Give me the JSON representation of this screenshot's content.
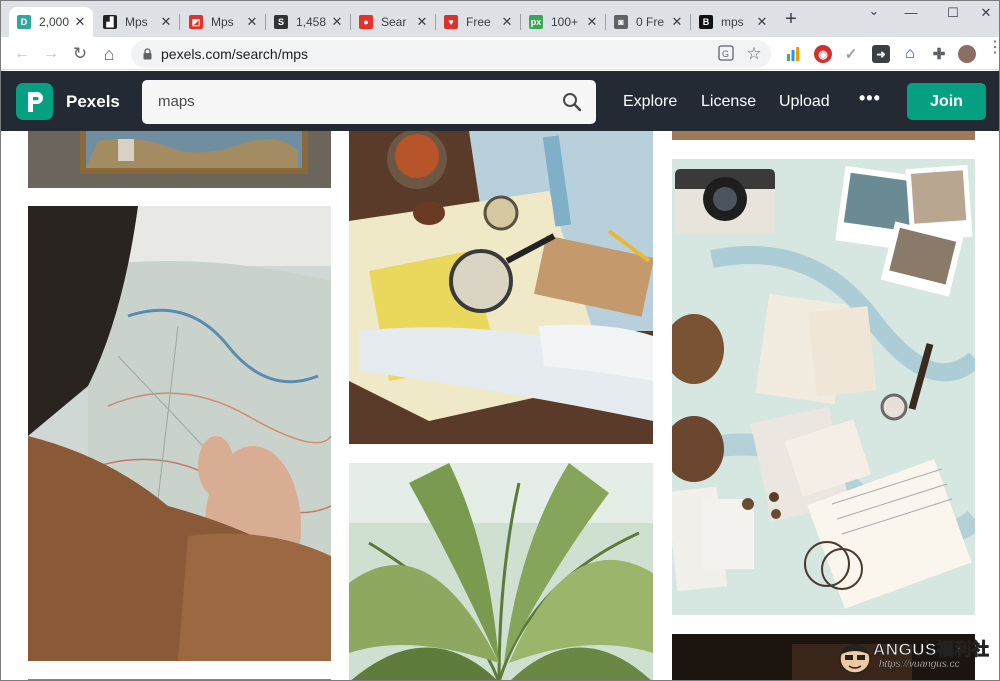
{
  "browser": {
    "tabs": [
      {
        "title": "2,000",
        "color": "#2ea7a0",
        "glyph": "D",
        "active": true
      },
      {
        "title": "Mps",
        "color": "#222222",
        "glyph": "▟",
        "active": false
      },
      {
        "title": "Mps",
        "color": "#e4322b",
        "glyph": "◩",
        "active": false
      },
      {
        "title": "1,458",
        "color": "#333333",
        "glyph": "S",
        "active": false
      },
      {
        "title": "Sear",
        "color": "#e4322b",
        "glyph": "●",
        "active": false
      },
      {
        "title": "Free",
        "color": "#d9342b",
        "glyph": "♥",
        "active": false
      },
      {
        "title": "100+",
        "color": "#3aa757",
        "glyph": "px",
        "active": false
      },
      {
        "title": "0 Fre",
        "color": "#5f6368",
        "glyph": "◙",
        "active": false
      },
      {
        "title": "mps",
        "color": "#111111",
        "glyph": "B",
        "active": false
      }
    ],
    "new_tab_label": "+",
    "window_controls": {
      "minimize": "—",
      "maximize": "☐",
      "close": "✕",
      "collapse": "⌄"
    },
    "url": "pexels.com/search/mps",
    "nav": {
      "back": "←",
      "forward": "→",
      "reload": "↻",
      "home": "⌂"
    }
  },
  "pexels": {
    "logo_text": "Pexels",
    "search_value": "maps",
    "nav_links": [
      "Explore",
      "License",
      "Upload"
    ],
    "more_label": "•••",
    "join_label": "Join",
    "accent": "#05a081",
    "header_bg": "#232a34"
  },
  "watermark": {
    "title": "ANGUS福利社",
    "url": "https://vuangus.cc"
  }
}
